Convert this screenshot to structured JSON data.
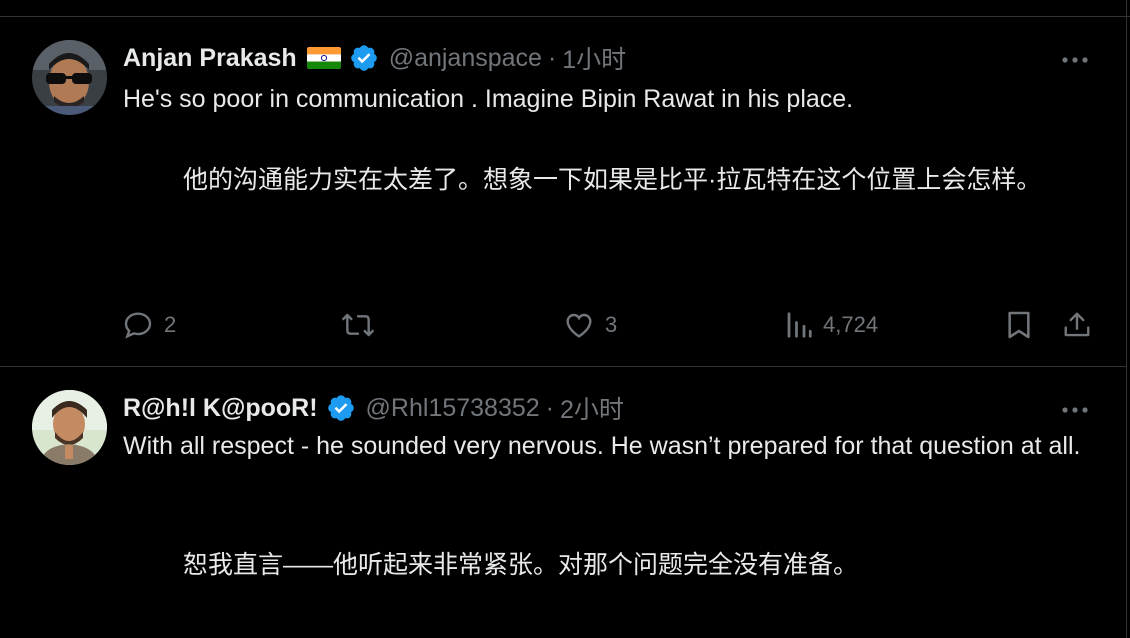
{
  "tweets": [
    {
      "display_name": "Anjan Prakash",
      "flag": "india-flag",
      "verified": true,
      "handle": "@anjanspace",
      "separator": "·",
      "time": "1小时",
      "text": "He's so poor in communication . Imagine Bipin Rawat in his place.",
      "translation": "他的沟通能力实在太差了。想象一下如果是比平·拉瓦特在这个位置上会怎样。",
      "actions": {
        "replies": "2",
        "reposts": "",
        "likes": "3",
        "views": "4,724"
      }
    },
    {
      "display_name": "R@h!l K@pooR!",
      "verified": true,
      "handle": "@Rhl15738352",
      "separator": "·",
      "time": "2小时",
      "text": "With all respect - he sounded very nervous. He wasn’t prepared for that question at all.",
      "translation": "恕我直言——他听起来非常紧张。对那个问题完全没有准备。"
    }
  ],
  "colors": {
    "background": "#000000",
    "text": "#e7e9ea",
    "muted": "#71767b",
    "divider": "#2f3336",
    "verified": "#1d9bf0"
  },
  "icons": [
    "more-icon",
    "reply-icon",
    "repost-icon",
    "like-icon",
    "views-icon",
    "bookmark-icon",
    "share-icon",
    "verified-badge-icon"
  ]
}
